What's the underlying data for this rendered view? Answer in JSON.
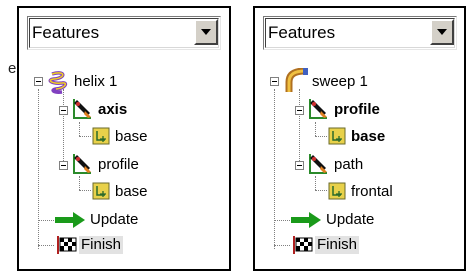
{
  "left_panel": {
    "dropdown_value": "Features",
    "items": {
      "root": "helix 1",
      "axis": "axis",
      "axis_child": "base",
      "profile": "profile",
      "profile_child": "base",
      "update": "Update",
      "finish": "Finish"
    }
  },
  "right_panel": {
    "dropdown_value": "Features",
    "items": {
      "root": "sweep 1",
      "profile": "profile",
      "profile_child": "base",
      "path": "path",
      "path_child": "frontal",
      "update": "Update",
      "finish": "Finish"
    }
  },
  "stray_text": "e",
  "colors": {
    "border": "#000000",
    "button_face": "#d4d0c8",
    "update_arrow": "#1a9a1a",
    "base_icon_fill": "#e8d14a",
    "selection_bg": "#e2e2e2"
  },
  "icons": [
    "helix-icon",
    "sweep-icon",
    "sketch-icon",
    "base-plane-icon",
    "update-arrow-icon",
    "finish-flag-icon"
  ]
}
